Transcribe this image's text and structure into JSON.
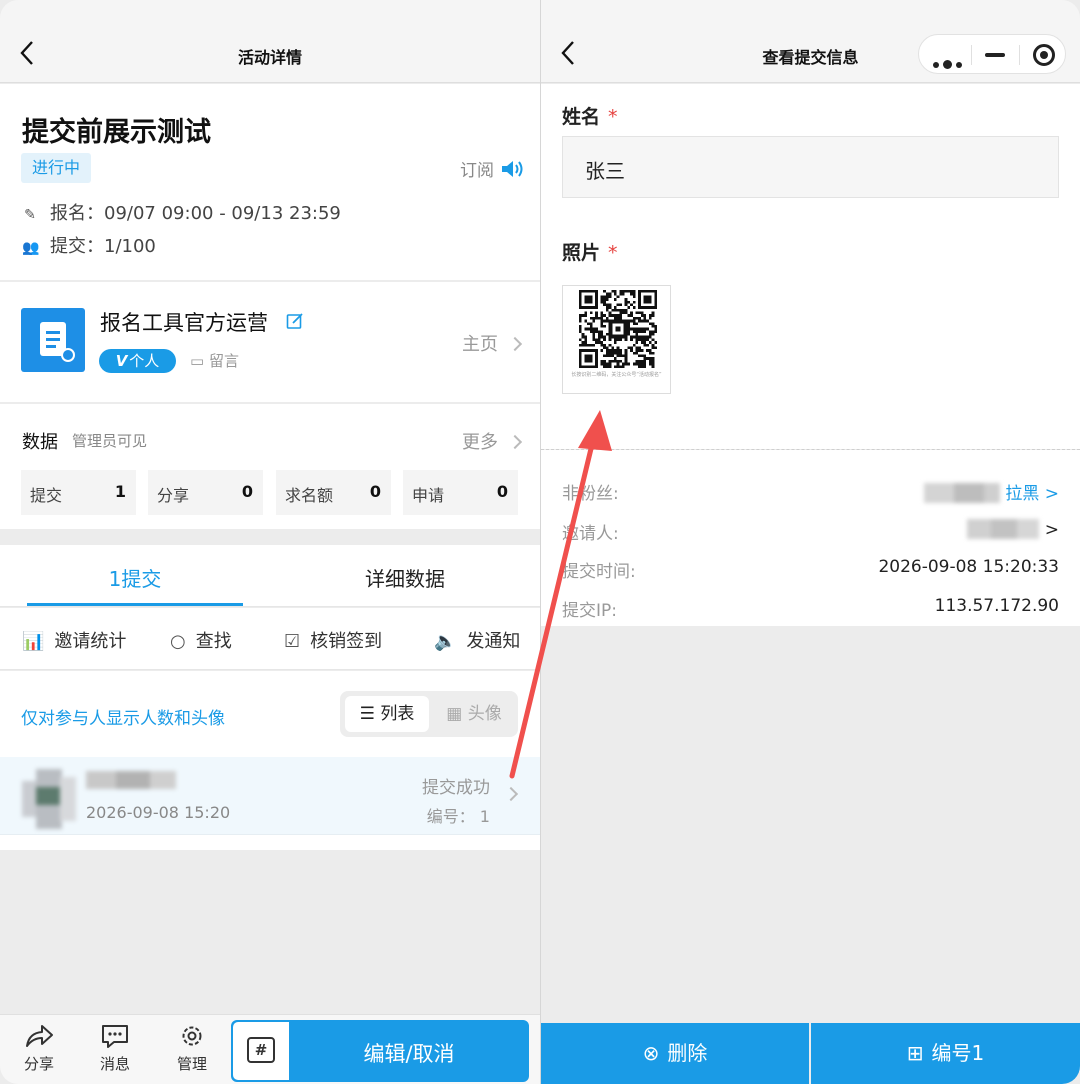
{
  "left": {
    "nav_title": "活动详情",
    "activity": {
      "title": "提交前展示测试",
      "status": "进行中",
      "subscribe": "订阅",
      "signup_label": "报名：",
      "signup_range": "09/07 09:00 - 09/13 23:59",
      "submit_label": "提交：",
      "submit_count": "1/100"
    },
    "organizer": {
      "name": "报名工具官方运营",
      "badge_v": "V",
      "badge_text": "个人",
      "message": "留言",
      "home": "主页"
    },
    "data": {
      "title": "数据",
      "subtitle": "管理员可见",
      "more": "更多",
      "stats": [
        {
          "label": "提交",
          "value": "1"
        },
        {
          "label": "分享",
          "value": "0"
        },
        {
          "label": "求名额",
          "value": "0"
        },
        {
          "label": "申请",
          "value": "0"
        }
      ]
    },
    "tabs": {
      "active": "1提交",
      "other": "详细数据"
    },
    "tools": {
      "invite": "邀请统计",
      "search": "查找",
      "checkin": "核销签到",
      "notify": "发通知"
    },
    "filter": {
      "link": "仅对参与人显示人数和头像",
      "list": "列表",
      "avatar": "头像"
    },
    "entry": {
      "time": "2026-09-08 15:20",
      "status": "提交成功",
      "number": "编号：  1"
    },
    "bottom": {
      "share": "分享",
      "message": "消息",
      "manage": "管理",
      "tag": "#",
      "main": "编辑/取消"
    }
  },
  "right": {
    "nav_title": "查看提交信息",
    "name_label": "姓名",
    "required": "*",
    "name_value": "张三",
    "photo_label": "照片",
    "photo_caption": "长按识别二维码，关注公众号“活动报名”",
    "meta": {
      "fan_label": "非粉丝:",
      "block": "拉黑 >",
      "inviter_label": "邀请人:",
      "inviter_arrow": ">",
      "time_label": "提交时间:",
      "time_value": "2026-09-08 15:20:33",
      "ip_label": "提交IP:",
      "ip_value": "113.57.172.90"
    },
    "buttons": {
      "delete": "删除",
      "number": "编号1"
    }
  },
  "colors": {
    "accent": "#1a9be6",
    "required": "#e64340",
    "arrow": "#f0504d"
  }
}
